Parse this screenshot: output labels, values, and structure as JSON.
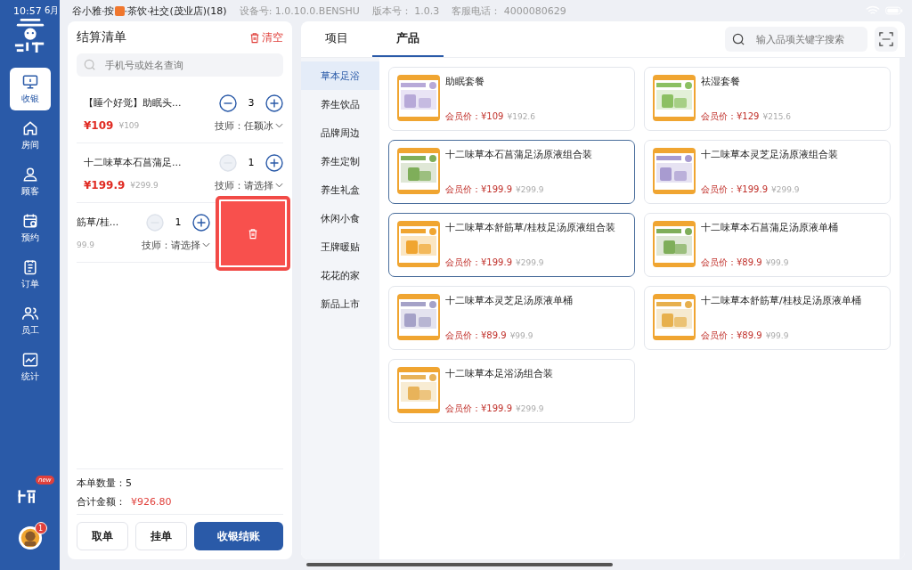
{
  "status_bar": {
    "time": "10:57",
    "date": "6月",
    "store": [
      "谷小雅·按",
      "·茶饮·社交(茂业店)(18)"
    ],
    "device": "设备号: 1.0.10.0.BENSHU",
    "version": "版本号：  1.0.3",
    "hotline": "客服电话：  4000080629"
  },
  "sidebar": {
    "items": [
      {
        "label": "收银",
        "selected": true
      },
      {
        "label": "房间",
        "selected": false
      },
      {
        "label": "顾客",
        "selected": false
      },
      {
        "label": "预约",
        "selected": false
      },
      {
        "label": "订单",
        "selected": false
      },
      {
        "label": "员工",
        "selected": false
      },
      {
        "label": "统计",
        "selected": false
      }
    ],
    "new_badge": "new",
    "avatar_badge": "1"
  },
  "cart": {
    "title": "结算清单",
    "clear": "清空",
    "search": {
      "placeholder": "手机号或姓名查询"
    },
    "items": [
      {
        "name": "【睡个好觉】助眠头...",
        "price": "¥109",
        "original": "¥109",
        "qty": "3",
        "minus_disabled": false,
        "tech_label": "技师：",
        "tech": "任颖冰",
        "swiped": false
      },
      {
        "name": "十二味草本石菖蒲足...",
        "price": "¥199.9",
        "original": "¥299.9",
        "qty": "1",
        "minus_disabled": true,
        "tech_label": "技师：",
        "tech": "请选择",
        "swiped": false
      },
      {
        "name": "筋草/桂...",
        "original": "99.9",
        "qty": "1",
        "minus_disabled": true,
        "tech_label": "技师：",
        "tech": "请选择",
        "swiped": true
      }
    ],
    "count_label": "本单数量：",
    "count": "5",
    "total_label": "合计金额：",
    "total": "¥926.80",
    "buttons": [
      {
        "label": "取单",
        "kind": "outline"
      },
      {
        "label": "挂单",
        "kind": "outline"
      },
      {
        "label": "收银结账",
        "kind": "primary"
      }
    ]
  },
  "tabs": [
    {
      "label": "项目",
      "selected": false
    },
    {
      "label": "产品",
      "selected": true
    }
  ],
  "product_search": {
    "placeholder": "输入品项关键字搜索"
  },
  "categories": [
    {
      "label": "草本足浴",
      "selected": true
    },
    {
      "label": "养生饮品",
      "selected": false
    },
    {
      "label": "品牌周边",
      "selected": false
    },
    {
      "label": "养生定制",
      "selected": false
    },
    {
      "label": "养生礼盒",
      "selected": false
    },
    {
      "label": "休闲小食",
      "selected": false
    },
    {
      "label": "王牌暖贴",
      "selected": false
    },
    {
      "label": "花花的家",
      "selected": false
    },
    {
      "label": "新品上市",
      "selected": false
    }
  ],
  "products": [
    {
      "name": "助眠套餐",
      "price_label": "会员价：",
      "price": "¥109",
      "original": "¥192.6",
      "selected": false
    },
    {
      "name": "祛湿套餐",
      "price_label": "会员价：",
      "price": "¥129",
      "original": "¥215.6",
      "selected": false
    },
    {
      "name": "十二味草本石菖蒲足汤原液组合装",
      "price_label": "会员价：",
      "price": "¥199.9",
      "original": "¥299.9",
      "selected": true
    },
    {
      "name": "十二味草本灵芝足汤原液组合装",
      "price_label": "会员价：",
      "price": "¥199.9",
      "original": "¥299.9",
      "selected": false
    },
    {
      "name": "十二味草本舒筋草/桂枝足汤原液组合装",
      "price_label": "会员价：",
      "price": "¥199.9",
      "original": "¥299.9",
      "selected": true
    },
    {
      "name": "十二味草本石菖蒲足汤原液单桶",
      "price_label": "会员价：",
      "price": "¥89.9",
      "original": "¥99.9",
      "selected": false
    },
    {
      "name": "十二味草本灵芝足汤原液单桶",
      "price_label": "会员价：",
      "price": "¥89.9",
      "original": "¥99.9",
      "selected": false
    },
    {
      "name": "十二味草本舒筋草/桂枝足汤原液单桶",
      "price_label": "会员价：",
      "price": "¥89.9",
      "original": "¥99.9",
      "selected": false
    },
    {
      "name": "十二味草本足浴汤组合装",
      "price_label": "会员价：",
      "price": "¥199.9",
      "original": "¥299.9",
      "selected": false
    }
  ]
}
